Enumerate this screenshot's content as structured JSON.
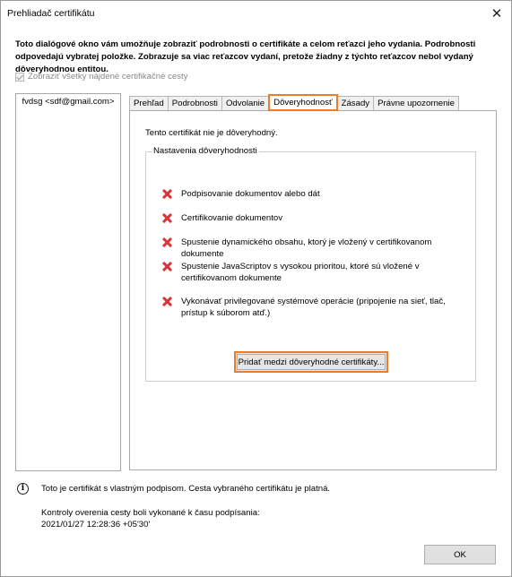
{
  "window": {
    "title": "Prehliadač certifikátu",
    "close_glyph": "✕"
  },
  "description": "Toto dialógové okno vám umožňuje zobraziť podrobnosti o certifikáte a celom reťazci jeho vydania. Podrobnosti odpovedajú vybratej položke. Zobrazuje sa viac reťazcov vydaní, pretože žiadny z týchto reťazcov nebol vydaný dôveryhodnou entitou.",
  "show_all": {
    "label": "Zobraziť všetky nájdené certifikačné cesty",
    "checked": true,
    "disabled": true
  },
  "cert_list": {
    "items": [
      "fvdsg <sdf@gmail.com>"
    ]
  },
  "tabs": [
    {
      "label": "Prehľad",
      "active": false
    },
    {
      "label": "Podrobnosti",
      "active": false
    },
    {
      "label": "Odvolanie",
      "active": false
    },
    {
      "label": "Dôveryhodnosť",
      "active": true
    },
    {
      "label": "Zásady",
      "active": false
    },
    {
      "label": "Právne upozornenie",
      "active": false
    }
  ],
  "trust": {
    "status": "Tento certifikát nie je dôveryhodný.",
    "group_label": "Nastavenia dôveryhodnosti",
    "permissions": [
      "Podpisovanie dokumentov alebo dát",
      "Certifikovanie dokumentov",
      "Spustenie dynamického obsahu, ktorý je vložený v certifikovanom dokumente",
      "Spustenie JavaScriptov s vysokou prioritou, ktoré sú vložené v certifikovanom dokumente",
      "Vykonávať privilegované systémové operácie (pripojenie na sieť, tlač, prístup k súborom atď.)"
    ],
    "add_button": "Pridať medzi dôveryhodné certifikáty..."
  },
  "footer": {
    "info_glyph": "i",
    "status": "Toto je certifikát s vlastným podpisom. Cesta vybraného certifikátu je platná.",
    "checks_line1": "Kontroly overenia cesty boli vykonané k času podpísania:",
    "checks_line2": "2021/01/27 12:28:36 +05'30'",
    "ok_label": "OK"
  },
  "colors": {
    "highlight": "#f07b25",
    "deny_icon": "#d8343a"
  }
}
